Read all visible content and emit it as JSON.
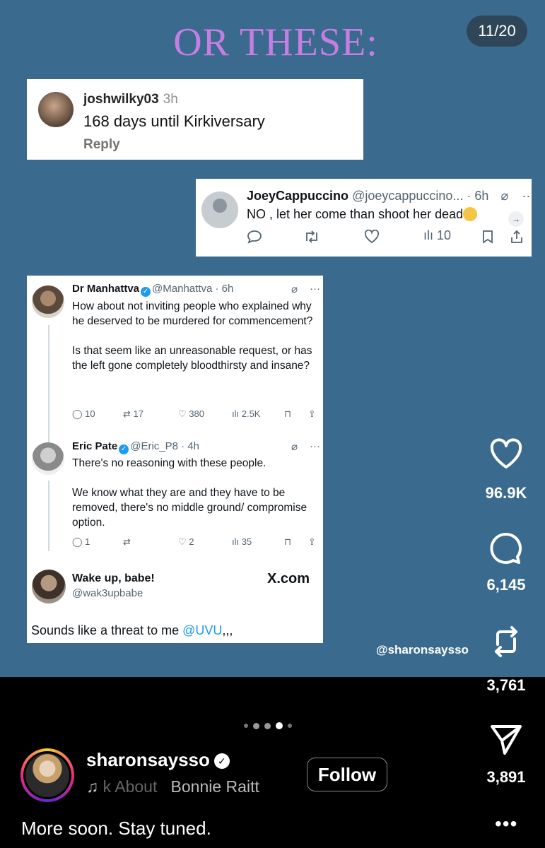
{
  "slide_counter": "11/20",
  "headline": "OR THESE:",
  "comment1": {
    "username": "joshwilky03",
    "time": "3h",
    "text": "168 days until Kirkiversary",
    "reply_label": "Reply"
  },
  "comment2": {
    "name": "JoeyCappuccino",
    "meta": "@joeycappuccino... · 6h",
    "text": "NO , let her come than shoot her dead",
    "views": "10"
  },
  "thread": {
    "tweet1": {
      "name": "Dr Manhattva",
      "meta": "@Manhattva · 6h",
      "paragraphs": [
        "How about not inviting people who explained why he deserved to be murdered for commencement?",
        "Is that seem like an unreasonable request, or has the left gone completely bloodthirsty and insane?"
      ],
      "replies": "10",
      "reposts": "17",
      "likes": "380",
      "views": "2.5K"
    },
    "tweet2": {
      "name": "Eric Pate",
      "meta": "@Eric_P8 · 4h",
      "paragraphs": [
        "There's no reasoning with these people.",
        "We know what they are and they have to be removed, there's no middle ground/ compromise option."
      ],
      "replies": "1",
      "reposts": "",
      "likes": "2",
      "views": "35"
    },
    "source": {
      "name": "Wake up, babe!",
      "handle": "@wak3upbabe",
      "site": "X.com"
    },
    "footer_text": "Sounds like a threat to me ",
    "footer_mention": "@UVU",
    "footer_tail": ",,,"
  },
  "watermark": "@sharonsaysso",
  "rail": {
    "likes": "96.9K",
    "comments": "6,145",
    "reposts": "3,761",
    "shares": "3,891"
  },
  "author": {
    "username": "sharonsaysso",
    "music_prefix": "k About",
    "music_artist": "Bonnie Raitt",
    "follow_label": "Follow"
  },
  "caption": "More soon. Stay tuned.",
  "more_label": "•••",
  "icons": [
    "heart-icon",
    "comment-icon",
    "repost-icon",
    "share-icon",
    "music-note-icon",
    "verified-badge-icon",
    "more-icon"
  ]
}
